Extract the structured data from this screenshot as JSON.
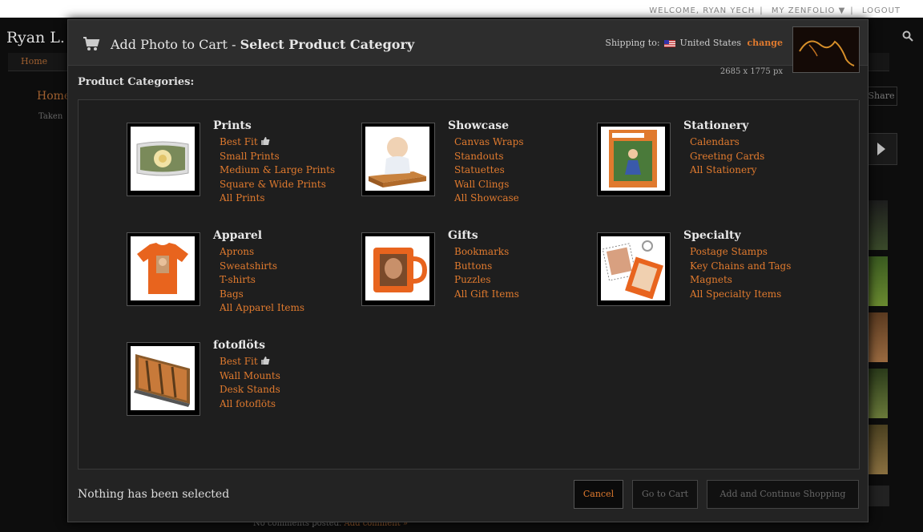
{
  "background": {
    "site_title": "Ryan L.",
    "top_nav": [
      "WELCOME, RYAN YECH",
      "MY ZENFOLIO ▼",
      "LOGOUT"
    ],
    "nav_home": "Home",
    "breadcrumb_home": "Home",
    "taken_label": "Taken",
    "share_label": "Share",
    "comments_text": "No comments posted.",
    "add_comment_link": "Add comment »"
  },
  "modal": {
    "title_prefix": "Add Photo to Cart - ",
    "title_bold": "Select Product Category",
    "shipping_label": "Shipping to:",
    "shipping_country": "United States",
    "change_link": "change",
    "dimensions": "2685 x 1775 px",
    "categories_heading": "Product Categories:",
    "status_text": "Nothing has been selected",
    "buttons": {
      "cancel": "Cancel",
      "go_to_cart": "Go to Cart",
      "add_continue": "Add and Continue Shopping"
    }
  },
  "categories": [
    {
      "title": "Prints",
      "links": [
        "Best Fit",
        "Small Prints",
        "Medium & Large Prints",
        "Square & Wide Prints",
        "All Prints"
      ],
      "best_fit_icon": "thumbs-up-icon"
    },
    {
      "title": "Showcase",
      "links": [
        "Canvas Wraps",
        "Standouts",
        "Statuettes",
        "Wall Clings",
        "All Showcase"
      ]
    },
    {
      "title": "Stationery",
      "links": [
        "Calendars",
        "Greeting Cards",
        "All Stationery"
      ]
    },
    {
      "title": "Apparel",
      "links": [
        "Aprons",
        "Sweatshirts",
        "T-shirts",
        "Bags",
        "All Apparel Items"
      ]
    },
    {
      "title": "Gifts",
      "links": [
        "Bookmarks",
        "Buttons",
        "Puzzles",
        "All Gift Items"
      ]
    },
    {
      "title": "Specialty",
      "links": [
        "Postage Stamps",
        "Key Chains and Tags",
        "Magnets",
        "All Specialty Items"
      ]
    },
    {
      "title": "fotoflöts",
      "links": [
        "Best Fit",
        "Wall Mounts",
        "Desk Stands",
        "All fotoflöts"
      ],
      "best_fit_icon": "thumbs-up-icon"
    }
  ],
  "colors": {
    "accent": "#e07a2e",
    "modal_bg": "#232323",
    "page_bg": "#0d0d0d"
  }
}
